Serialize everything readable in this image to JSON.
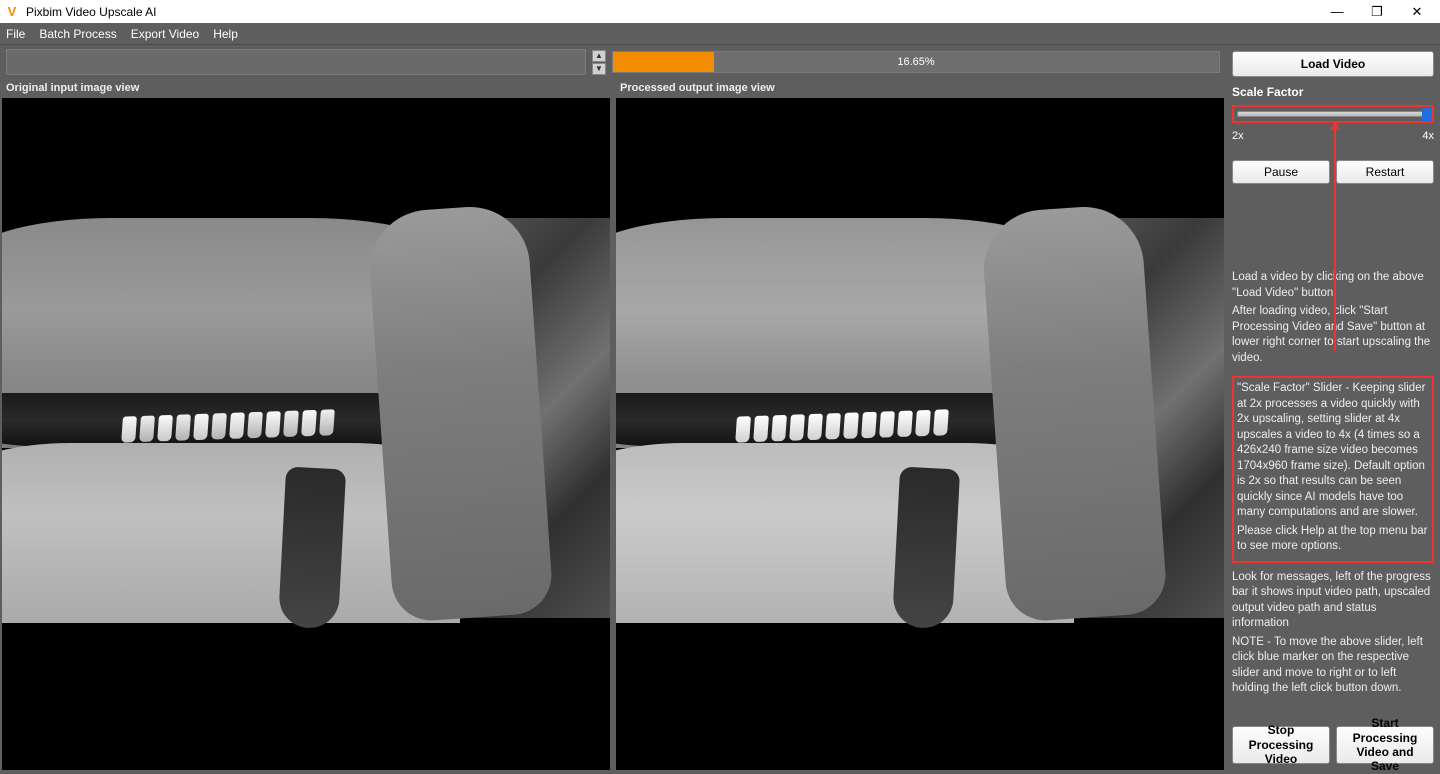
{
  "app": {
    "title": "Pixbim Video Upscale AI"
  },
  "menu": {
    "file": "File",
    "batch": "Batch Process",
    "export": "Export Video",
    "help": "Help"
  },
  "progress": {
    "percent": 16.65,
    "text": "16.65%"
  },
  "views": {
    "original_label": "Original input image view",
    "processed_label": "Processed output image view"
  },
  "sidebar": {
    "load_btn": "Load Video",
    "scale_label": "Scale Factor",
    "scale_min": "2x",
    "scale_max": "4x",
    "scale_value": 4,
    "pause_btn": "Pause",
    "restart_btn": "Restart",
    "instr1": "Load a video by clicking on the above \"Load Video\" button.",
    "instr2": "After loading video, click \"Start Processing Video and Save\" button at lower right corner to start upscaling the video.",
    "scale_instr1": "\"Scale Factor\" Slider - Keeping slider at 2x processes a video quickly with 2x upscaling, setting slider at 4x upscales a video to 4x (4 times so a 426x240 frame size video becomes 1704x960 frame size). Default option is 2x so that results can be seen quickly since AI models have too many computations and are slower.",
    "scale_instr2": "Please click Help at the top menu bar to see more options.",
    "instr3": "Look for messages, left of the progress bar it shows input video path, upscaled output video path and status information",
    "instr4": "NOTE - To move the above slider, left click blue marker on the respective slider and move to right or to left holding the left click button down.",
    "stop_btn": "Stop Processing Video",
    "start_btn": "Start Processing Video and Save"
  },
  "win": {
    "min": "—",
    "max": "❐",
    "close": "✕"
  }
}
